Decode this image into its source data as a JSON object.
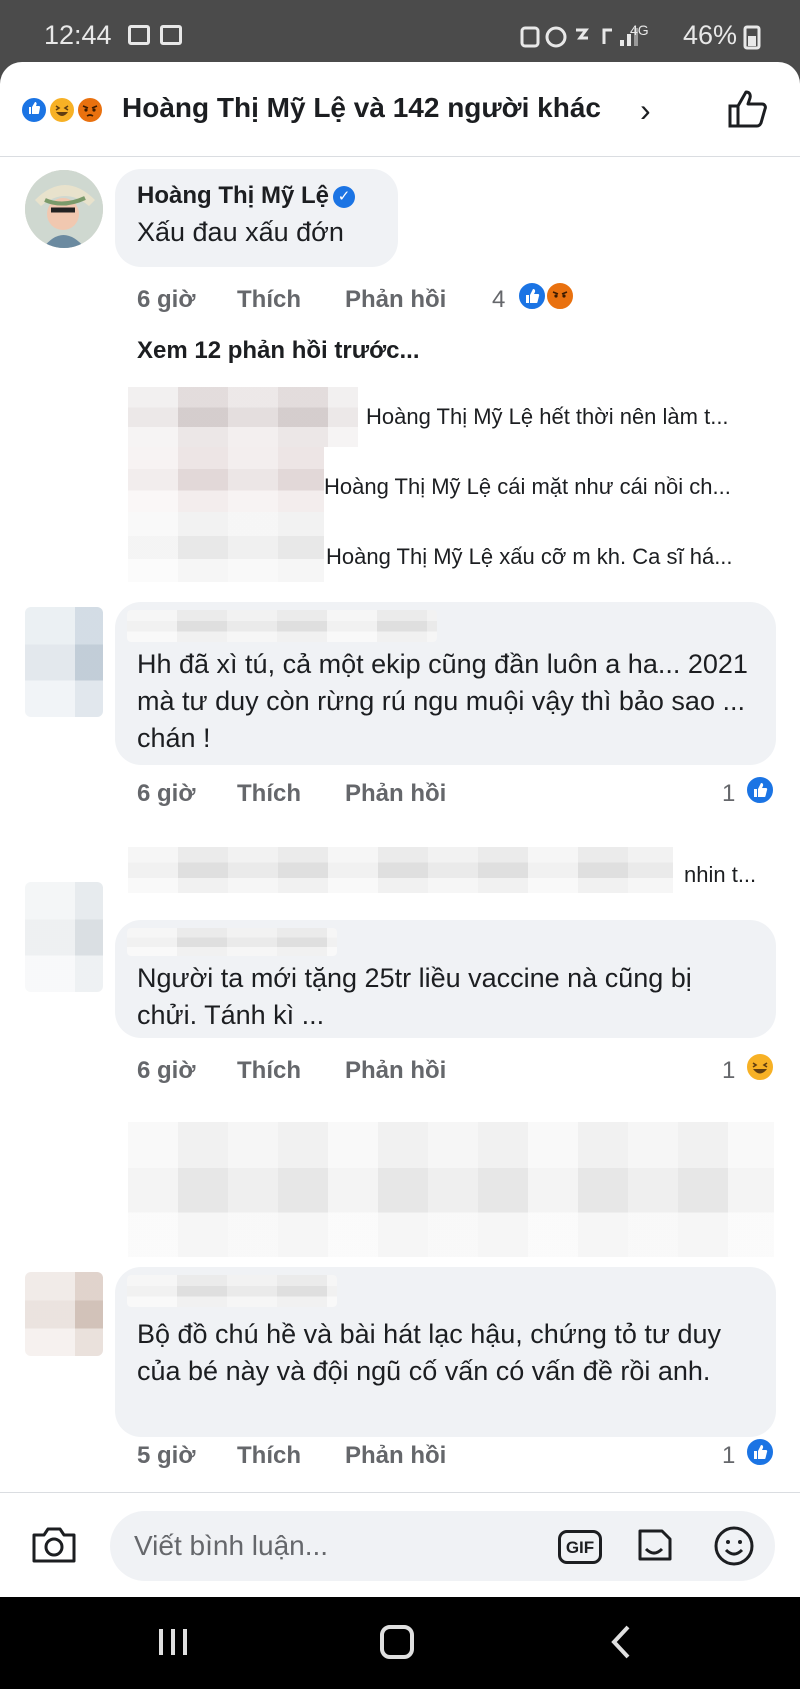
{
  "status_bar": {
    "time": "12:44",
    "signal_text": "4G",
    "battery": "46%"
  },
  "reactions_header": {
    "summary": "Hoàng Thị Mỹ Lệ và 142 người khác",
    "reaction_icons": [
      "like-icon",
      "haha-icon",
      "angry-icon"
    ]
  },
  "comments": [
    {
      "author": "Hoàng Thị Mỹ Lệ",
      "verified": true,
      "text": "Xấu đau xấu đớn",
      "time": "6 giờ",
      "like_label": "Thích",
      "reply_label": "Phản hồi",
      "reaction_count": "4",
      "reactions": [
        "like",
        "angry"
      ]
    },
    {
      "author": "",
      "text": "Hh đã xì tú, cả một ekip cũng đần luôn a ha... 2021 mà tư duy còn rừng rú ngu muội vậy thì bảo sao ... chán !",
      "time": "6 giờ",
      "like_label": "Thích",
      "reply_label": "Phản hồi",
      "reaction_count": "1",
      "reactions": [
        "like"
      ]
    },
    {
      "author": "",
      "text": "Người ta mới tặng 25tr liều vaccine nà cũng bị chửi. Tánh kì ...",
      "time": "6 giờ",
      "like_label": "Thích",
      "reply_label": "Phản hồi",
      "reaction_count": "1",
      "reactions": [
        "haha"
      ]
    },
    {
      "author": "",
      "text": "Bộ đồ chú hề và bài hát lạc hậu, chứng tỏ tư duy của bé này và đội ngũ cố vấn có vấn đề rồi anh.",
      "time": "5 giờ",
      "like_label": "Thích",
      "reply_label": "Phản hồi",
      "reaction_count": "1",
      "reactions": [
        "like"
      ]
    }
  ],
  "view_previous_replies": "Xem 12 phản hồi trước...",
  "replies": [
    "Hoàng Thị Mỹ Lệ hết thời nên làm t...",
    "Hoàng Thị Mỹ Lệ cái mặt như cái nồi ch...",
    "Hoàng Thị Mỹ Lệ xấu cỡ m kh. Ca sĩ há..."
  ],
  "reply_after_second": "nhin t...",
  "composer": {
    "placeholder": "Viết bình luận...",
    "gif_label": "GIF"
  },
  "colors": {
    "facebook_blue": "#1b74e4",
    "haha_yellow": "#f7b125",
    "angry_orange": "#e9710f",
    "bubble_gray": "#f0f2f5",
    "meta_gray": "#65676b"
  }
}
